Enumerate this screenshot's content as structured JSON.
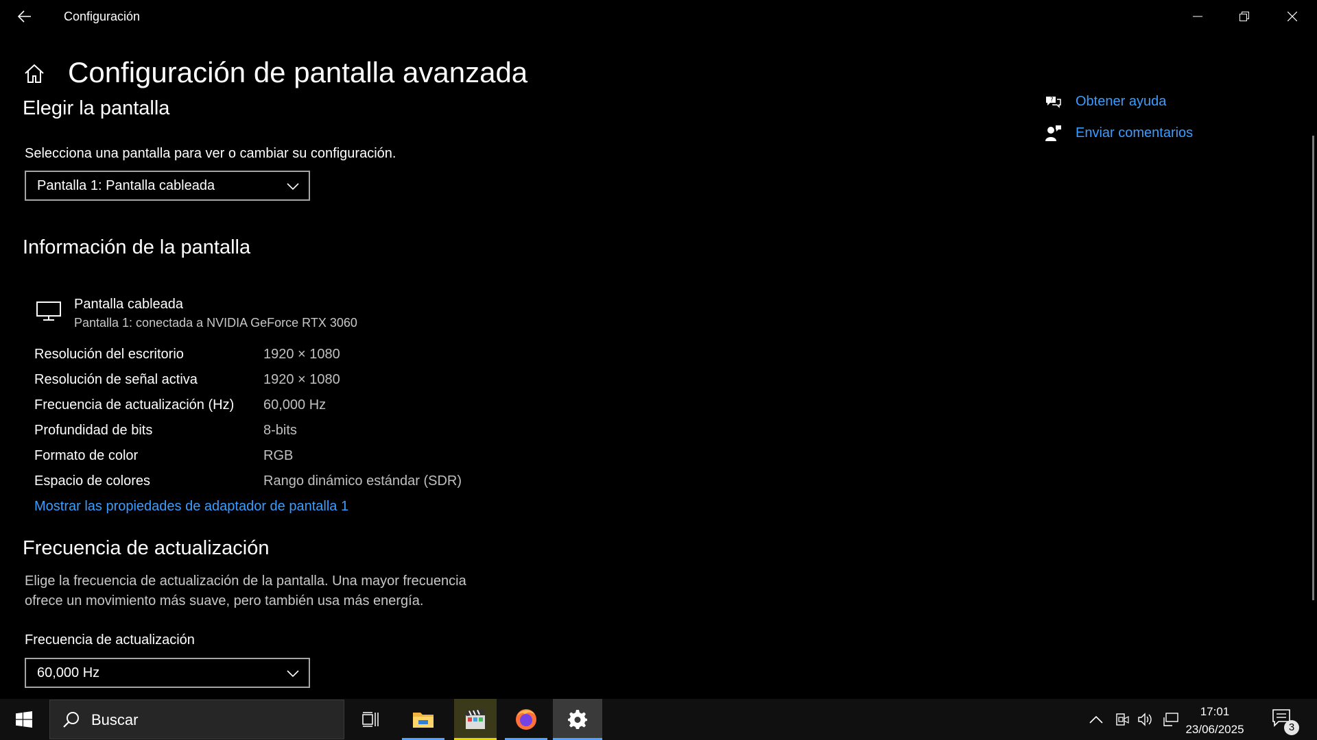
{
  "window": {
    "title": "Configuración"
  },
  "page": {
    "title": "Configuración de pantalla avanzada"
  },
  "choose_display": {
    "heading": "Elegir la pantalla",
    "description": "Selecciona una pantalla para ver o cambiar su configuración.",
    "selected": "Pantalla 1: Pantalla cableada"
  },
  "display_info": {
    "heading": "Información de la pantalla",
    "device_name": "Pantalla cableada",
    "device_subtitle": "Pantalla 1: conectada a NVIDIA GeForce RTX 3060",
    "rows": [
      {
        "label": "Resolución del escritorio",
        "value": "1920 × 1080"
      },
      {
        "label": "Resolución de señal activa",
        "value": "1920 × 1080"
      },
      {
        "label": "Frecuencia de actualización (Hz)",
        "value": "60,000 Hz"
      },
      {
        "label": "Profundidad de bits",
        "value": "8-bits"
      },
      {
        "label": "Formato de color",
        "value": "RGB"
      },
      {
        "label": "Espacio de colores",
        "value": "Rango dinámico estándar (SDR)"
      }
    ],
    "adapter_link": "Mostrar las propiedades de adaptador de pantalla 1"
  },
  "refresh_rate": {
    "heading": "Frecuencia de actualización",
    "description_line1": "Elige la frecuencia de actualización de la pantalla. Una mayor frecuencia",
    "description_line2": "ofrece un movimiento más suave, pero también usa más energía.",
    "field_label": "Frecuencia de actualización",
    "selected": "60,000 Hz"
  },
  "help": {
    "get_help": "Obtener ayuda",
    "send_feedback": "Enviar comentarios"
  },
  "taskbar": {
    "search_placeholder": "Buscar",
    "time": "17:01",
    "date": "23/06/2025",
    "notification_count": "3"
  },
  "colors": {
    "accent_link": "#3b9dff",
    "background": "#000000",
    "taskbar": "#101010"
  }
}
